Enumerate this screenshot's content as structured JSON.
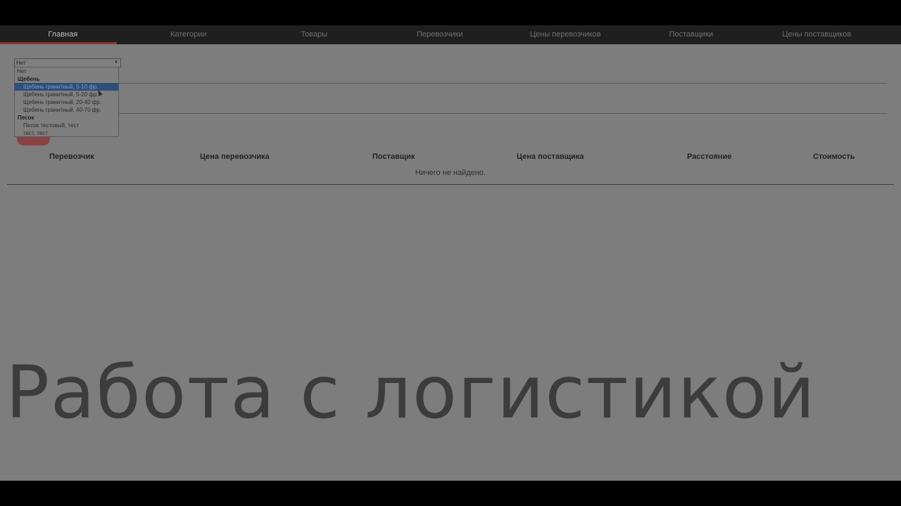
{
  "nav": {
    "items": [
      {
        "label": "Главная"
      },
      {
        "label": "Категории"
      },
      {
        "label": "Товары"
      },
      {
        "label": "Перевозчики"
      },
      {
        "label": "Цены перевозчиков"
      },
      {
        "label": "Поставщики"
      },
      {
        "label": "Цены поставщиков"
      }
    ],
    "active_index": 0
  },
  "select": {
    "value": "Нет",
    "options": {
      "none": "Нет",
      "group1": "Щебень",
      "group1_items": [
        "Щебень гранитный, 5-10 фр.",
        "Щебень гранитный, 5-20 фр.",
        "Щебень гранитный, 20-40 фр.",
        "Щебень гранитный, 40-70 фр."
      ],
      "group2": "Песок",
      "group2_items": [
        "Песок тестовый, тест",
        "тест, тест"
      ],
      "highlighted": "Щебень гранитный, 5-10 фр."
    }
  },
  "table": {
    "headers": [
      "Перевозчик",
      "Цена перевозчика",
      "Поставщик",
      "Цена поставщика",
      "Расстояние",
      "Стоимость"
    ],
    "empty_message": "Ничего не найдено."
  },
  "overlay": {
    "title": "Работа с логистикой"
  },
  "colors": {
    "background": "#7d7d7d",
    "navbar": "#1f1f1f",
    "accent": "#8f3636",
    "highlight": "#2b4f79"
  }
}
